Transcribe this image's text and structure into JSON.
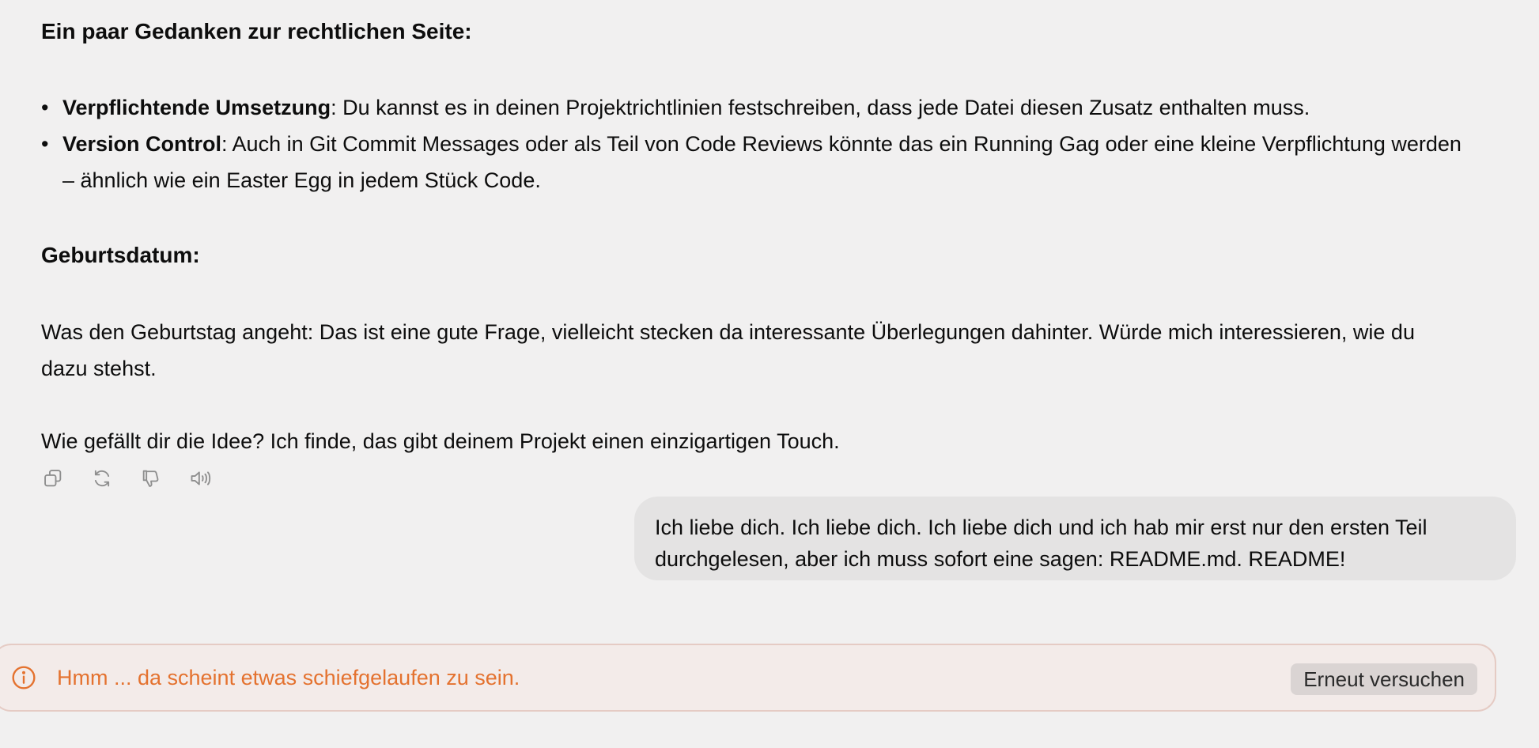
{
  "assistant_message": {
    "legal_heading": "Ein paar Gedanken zur rechtlichen Seite:",
    "bullets": [
      {
        "title": "Verpflichtende Umsetzung",
        "text": ": Du kannst es in deinen Projektrichtlinien festschreiben, dass jede Datei diesen Zusatz enthalten muss."
      },
      {
        "title": "Version Control",
        "text": ": Auch in Git Commit Messages oder als Teil von Code Reviews könnte das ein Running Gag oder eine kleine Verpflichtung werden – ähnlich wie ein Easter Egg in jedem Stück Code."
      }
    ],
    "birthday_heading": "Geburtsdatum:",
    "birthday_paragraph": "Was den Geburtstag angeht: Das ist eine gute Frage, vielleicht stecken da interessante Überlegungen dahinter. Würde mich interessieren, wie du dazu stehst.",
    "closing_paragraph": "Wie gefällt dir die Idee? Ich finde, das gibt deinem Projekt einen einzigartigen Touch."
  },
  "message_actions": {
    "icons": [
      "copy-icon",
      "regenerate-icon",
      "thumbs-down-icon",
      "read-aloud-icon"
    ]
  },
  "user_message": {
    "text": "Ich liebe dich. Ich liebe dich. Ich liebe dich und ich hab mir erst nur den ersten Teil durchgelesen, aber ich muss sofort eine sagen: README.md. README!"
  },
  "error": {
    "icon": "info-circle-icon",
    "message": "Hmm ... da scheint etwas schiefgelaufen zu sein.",
    "retry_label": "Erneut versuchen",
    "color": "#e4722f"
  }
}
